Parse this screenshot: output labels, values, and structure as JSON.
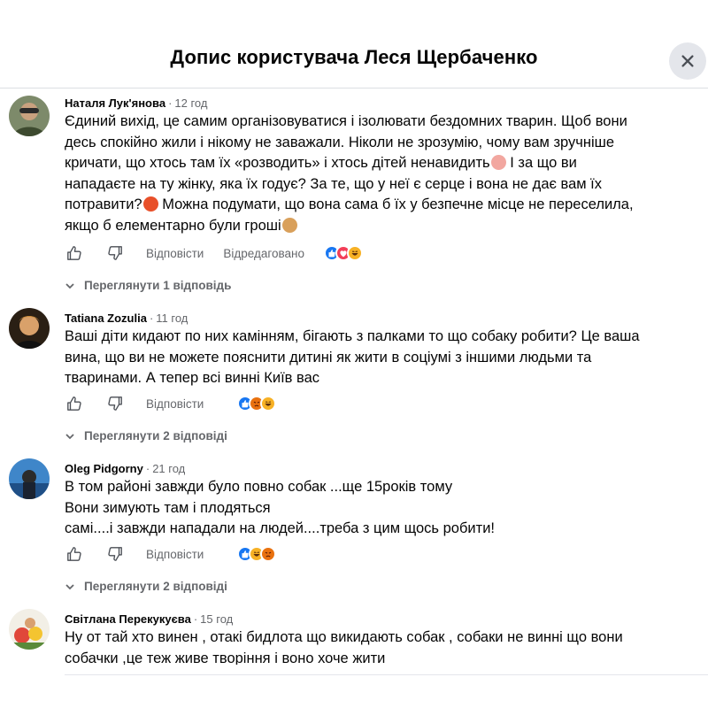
{
  "dialog": {
    "title": "Допис користувача Леся Щербаченко",
    "close_icon": "close-icon"
  },
  "actions": {
    "reply_label": "Відповісти"
  },
  "comments": [
    {
      "author": "Наталя Лук'янова",
      "time": "12 год",
      "lines": [
        "Єдиний вихід, це самим організовуватися і ізолювати бездомних тварин. Щоб вони",
        "десь спокійно жили і нікому не заважали. Ніколи не зрозумію, чому вам зручніше",
        "кричати, що хтось там їх «розводить» і хтось дітей ненавидить",
        "I за що ви",
        "нападаєте на ту жінку, яка їх годує? За те, що у неї є серце і вона не дає вам їх",
        "потравити?",
        "Можна подумати, що вона сама б їх у безпечне місце не переселила,",
        "якщо б елементарно були гроші"
      ],
      "edited_label": "Відредаговано",
      "reactions": [
        "like",
        "love",
        "haha"
      ],
      "replies": "Переглянути 1 відповідь"
    },
    {
      "author": "Tatiana Zozulia",
      "time": "11 год",
      "lines": [
        "Ваші діти кидают по них камінням, бігають з палками то що собаку робити? Це ваша",
        "вина, що ви не можете пояснити дитині як жити в соціумі з іншими людьми та",
        "тваринами. А тепер всі винні Київ вас"
      ],
      "reactions": [
        "like",
        "angry",
        "haha"
      ],
      "replies": "Переглянути 2 відповіді"
    },
    {
      "author": "Oleg Pidgorny",
      "time": "21 год",
      "lines": [
        "В том районі завжди було повно собак ...ще 15років тому",
        "Вони зимують там і плодяться",
        "самі....і завжди нападали на людей....треба з цим щось робити!"
      ],
      "reactions": [
        "like",
        "haha",
        "angry"
      ],
      "replies": "Переглянути 2 відповіді"
    },
    {
      "author": "Світлана Перекукуєва",
      "time": "15 год",
      "lines": [
        "Ну от тай хто винен , отакі бидлота що викидають собак , собаки не винні що вони",
        "собачки ,це теж живе творіння і воно хоче жити"
      ]
    }
  ],
  "colors": {
    "text": "#050505",
    "secondary": "#65676b",
    "like_blue": "#1877f2",
    "love_red": "#f33e58",
    "haha_yellow": "#f7b125",
    "angry_orange": "#e9710f",
    "close_bg": "#e4e6eb"
  }
}
